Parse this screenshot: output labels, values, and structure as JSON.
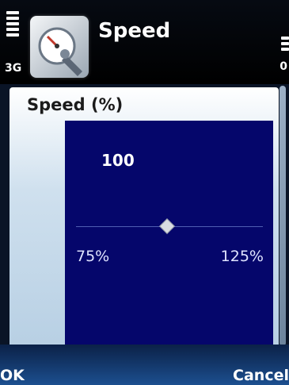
{
  "status": {
    "network": "3G",
    "signal_level": 5,
    "battery_indicator": "0"
  },
  "app": {
    "title": "Speed",
    "icon": "speedometer-wrench-icon"
  },
  "panel": {
    "title": "Speed (%)",
    "slider": {
      "value": "100",
      "min_label": "75%",
      "max_label": "125%",
      "level": 0.5
    }
  },
  "softkeys": {
    "left": "OK",
    "right": "Cancel"
  },
  "colors": {
    "slider_bg": "#05066b",
    "panel_gradient_end": "#b8d0e4"
  }
}
